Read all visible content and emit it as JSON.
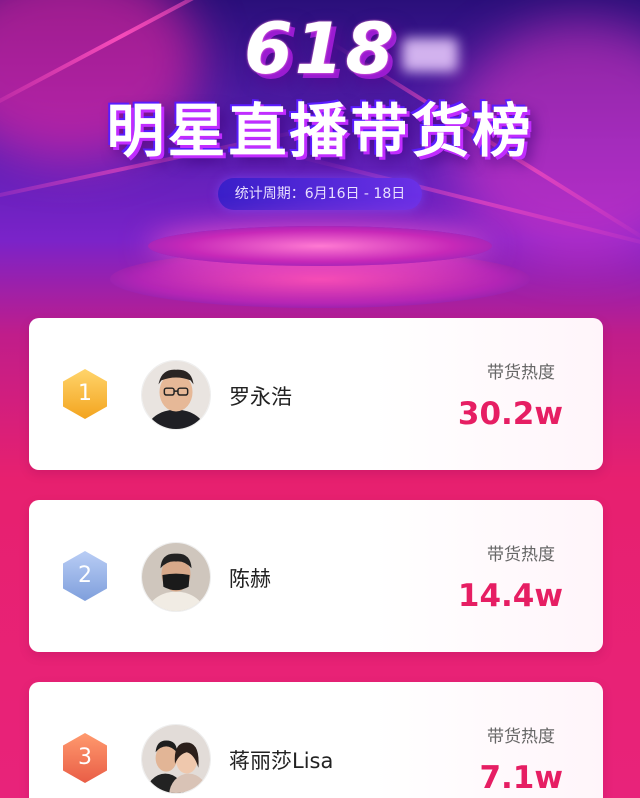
{
  "header": {
    "hero_number": "618",
    "title": "明星直播带货榜",
    "period": "统计周期：6月16日 - 18日"
  },
  "ranking": [
    {
      "rank": "1",
      "name": "罗永浩",
      "metric_label": "带货热度",
      "value": "30.2w",
      "badge_color": "#f3a41f"
    },
    {
      "rank": "2",
      "name": "陈赫",
      "metric_label": "带货热度",
      "value": "14.4w",
      "badge_color": "#7f9fdc"
    },
    {
      "rank": "3",
      "name": "蒋丽莎Lisa",
      "metric_label": "带货热度",
      "value": "7.1w",
      "badge_color": "#e95d46"
    }
  ],
  "colors": {
    "accent": "#e61e63",
    "background_top": "#2a0f7a",
    "background_bottom": "#e8237a"
  }
}
